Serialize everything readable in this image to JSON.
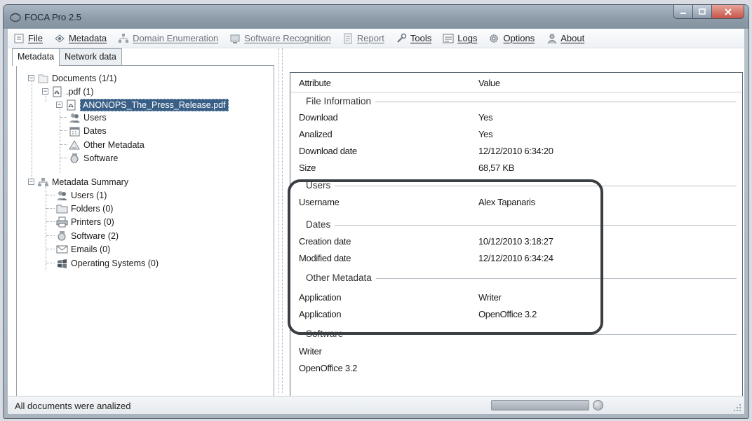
{
  "window": {
    "title": "FOCA Pro 2.5"
  },
  "menu": [
    {
      "label": "File",
      "icon": "file-icon"
    },
    {
      "label": "Metadata",
      "icon": "metadata-icon"
    },
    {
      "label": "Domain Enumeration",
      "icon": "domain-icon"
    },
    {
      "label": "Software Recognition",
      "icon": "software-icon"
    },
    {
      "label": "Report",
      "icon": "report-icon"
    },
    {
      "label": "Tools",
      "icon": "tools-icon"
    },
    {
      "label": "Logs",
      "icon": "logs-icon"
    },
    {
      "label": "Options",
      "icon": "options-icon"
    },
    {
      "label": "About",
      "icon": "about-icon"
    }
  ],
  "tabs": [
    {
      "label": "Metadata",
      "active": true
    },
    {
      "label": "Network data",
      "active": false
    }
  ],
  "tree": {
    "documents": "Documents (1/1)",
    "pdf": ".pdf (1)",
    "file": "ANONOPS_The_Press_Release.pdf",
    "users": "Users",
    "dates": "Dates",
    "other": "Other Metadata",
    "software": "Software",
    "summary": "Metadata Summary",
    "s_users": "Users (1)",
    "s_folders": "Folders (0)",
    "s_printers": "Printers (0)",
    "s_software": "Software (2)",
    "s_emails": "Emails (0)",
    "s_os": "Operating Systems (0)"
  },
  "grid": {
    "col_attr": "Attribute",
    "col_value": "Value",
    "groups": {
      "file_info": "File Information",
      "users": "Users",
      "dates": "Dates",
      "other": "Other Metadata",
      "software": "Software"
    },
    "rows": {
      "download": {
        "attr": "Download",
        "value": "Yes"
      },
      "analized": {
        "attr": "Analized",
        "value": "Yes"
      },
      "download_date": {
        "attr": "Download date",
        "value": "12/12/2010 6:34:20"
      },
      "size": {
        "attr": "Size",
        "value": "68,57 KB"
      },
      "username": {
        "attr": "Username",
        "value": "Alex Tapanaris"
      },
      "creation": {
        "attr": "Creation date",
        "value": "10/12/2010 3:18:27"
      },
      "modified": {
        "attr": "Modified date",
        "value": "12/12/2010 6:34:24"
      },
      "app1": {
        "attr": "Application",
        "value": "Writer"
      },
      "app2": {
        "attr": "Application",
        "value": "OpenOffice 3.2"
      },
      "sw1": {
        "attr": "Writer",
        "value": ""
      },
      "sw2": {
        "attr": "OpenOffice 3.2",
        "value": ""
      }
    }
  },
  "status": {
    "text": "All documents were analized",
    "progress": 1.0
  },
  "colors": {
    "selection": "#3a5f86",
    "highlight_border": "#3b3f44",
    "title_gradient": "#8d9aa8"
  }
}
